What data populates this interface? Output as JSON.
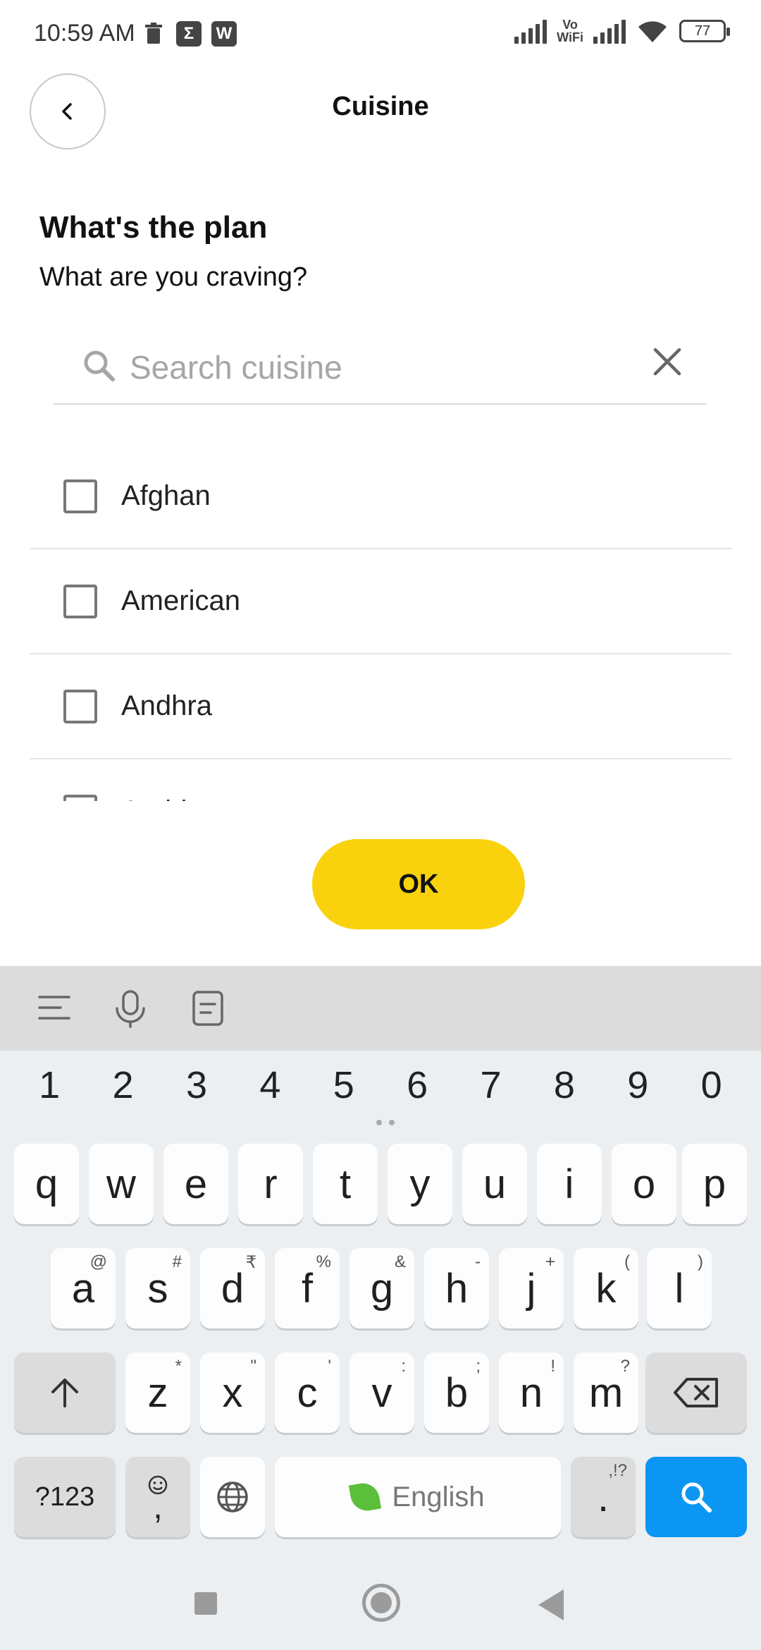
{
  "status_bar": {
    "time": "10:59 AM",
    "battery": "77",
    "vowifi_top": "Vo",
    "vowifi_bottom": "WiFi",
    "left_icons": [
      "trash-icon",
      "sigma-icon",
      "wps-icon"
    ]
  },
  "header": {
    "title": "Cuisine",
    "back_icon": "chevron-left-icon"
  },
  "content": {
    "heading": "What's the plan",
    "subheading": "What are you craving?"
  },
  "search": {
    "placeholder": "Search cuisine",
    "value": ""
  },
  "cuisines": [
    {
      "label": "Afghan",
      "checked": false
    },
    {
      "label": "American",
      "checked": false
    },
    {
      "label": "Andhra",
      "checked": false
    },
    {
      "label": "Arabian",
      "checked": false
    }
  ],
  "ok_button": {
    "label": "OK"
  },
  "colors": {
    "accent": "#f9d20d",
    "keyboard_action": "#0a96f2"
  },
  "keyboard": {
    "toolbar_icons": [
      "menu-icon",
      "microphone-icon",
      "clipboard-icon"
    ],
    "numbers": [
      "1",
      "2",
      "3",
      "4",
      "5",
      "6",
      "7",
      "8",
      "9",
      "0"
    ],
    "row1": [
      "q",
      "w",
      "e",
      "r",
      "t",
      "y",
      "u",
      "i",
      "o",
      "p"
    ],
    "row2": [
      {
        "key": "a",
        "alt": "@"
      },
      {
        "key": "s",
        "alt": "#"
      },
      {
        "key": "d",
        "alt": "₹"
      },
      {
        "key": "f",
        "alt": "%"
      },
      {
        "key": "g",
        "alt": "&"
      },
      {
        "key": "h",
        "alt": "-"
      },
      {
        "key": "j",
        "alt": "+"
      },
      {
        "key": "k",
        "alt": "("
      },
      {
        "key": "l",
        "alt": ")"
      }
    ],
    "row3": [
      {
        "key": "z",
        "alt": "*"
      },
      {
        "key": "x",
        "alt": "\""
      },
      {
        "key": "c",
        "alt": "'"
      },
      {
        "key": "v",
        "alt": ":"
      },
      {
        "key": "b",
        "alt": ";"
      },
      {
        "key": "n",
        "alt": "!"
      },
      {
        "key": "m",
        "alt": "?"
      }
    ],
    "symbols_key": "?123",
    "comma_key": ",",
    "space_label": "English",
    "period_key": ".",
    "period_alt": ",!?"
  }
}
